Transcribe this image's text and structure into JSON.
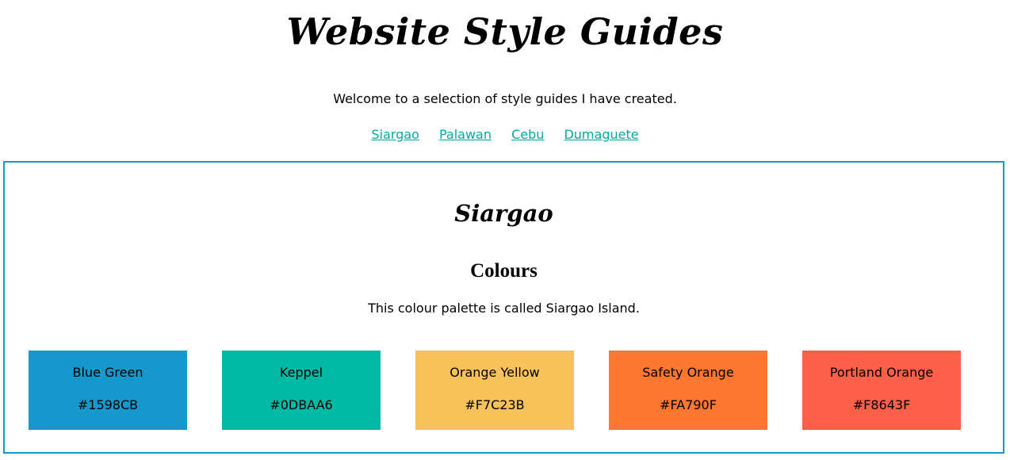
{
  "header": {
    "title": "Website Style Guides",
    "intro": "Welcome to a selection of style guides I have created."
  },
  "nav": {
    "links": [
      "Siargao",
      "Palawan",
      "Cebu",
      "Dumaguete"
    ],
    "link_color": "#00aaa0"
  },
  "section": {
    "title": "Siargao",
    "border_color": "#1598cb",
    "colours_heading": "Colours",
    "palette_description": "This colour palette is called Siargao Island.",
    "swatches": [
      {
        "name": "Blue Green",
        "hex": "#1598CB",
        "color": "#1598cb"
      },
      {
        "name": "Keppel",
        "hex": "#0DBAA6",
        "color": "#00baa6"
      },
      {
        "name": "Orange Yellow",
        "hex": "#F7C23B",
        "color": "#f7c25a"
      },
      {
        "name": "Safety Orange",
        "hex": "#FA790F",
        "color": "#fd7730"
      },
      {
        "name": "Portland Orange",
        "hex": "#F8643F",
        "color": "#fd6049"
      }
    ]
  }
}
